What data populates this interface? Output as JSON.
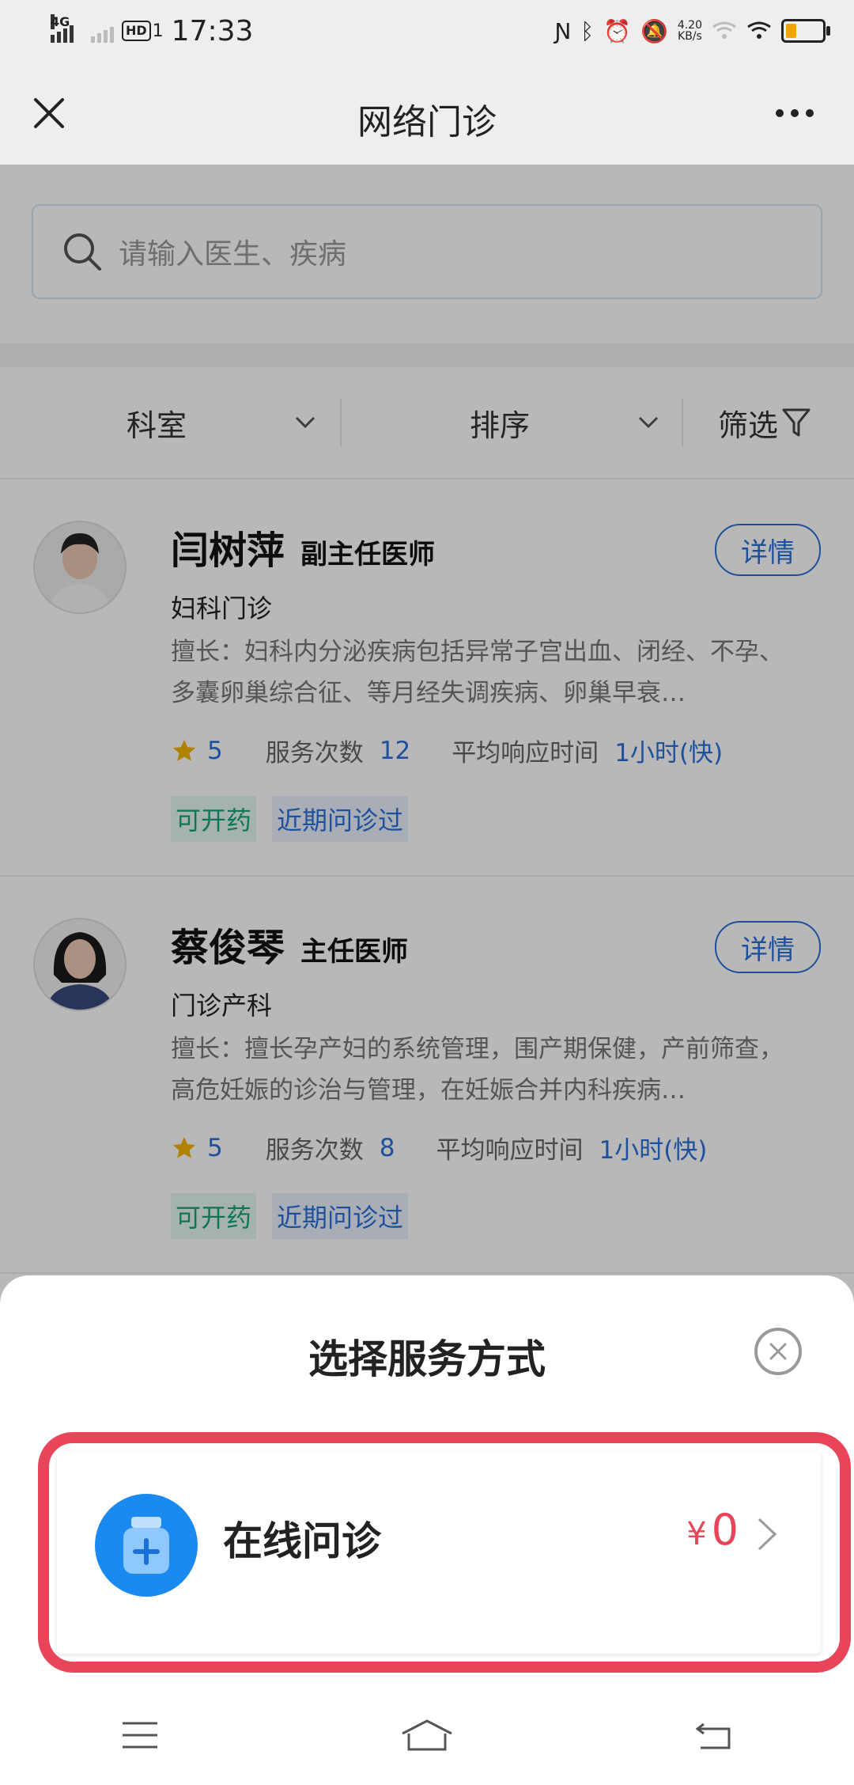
{
  "status_bar": {
    "network": "4G",
    "hd": "HD",
    "hd_sub": "1",
    "time": "17:33",
    "speed_value": "4.20",
    "speed_unit": "KB/s"
  },
  "nav": {
    "title": "网络门诊"
  },
  "search": {
    "placeholder": "请输入医生、疾病"
  },
  "filters": {
    "dept": "科室",
    "sort": "排序",
    "filter": "筛选"
  },
  "doctors": [
    {
      "name": "闫树萍",
      "title": "副主任医师",
      "detail_label": "详情",
      "dept": "妇科门诊",
      "skill": "擅长：妇科内分泌疾病包括异常子宫出血、闭经、不孕、多囊卵巢综合征、等月经失调疾病、卵巢早衰…",
      "rating": "5",
      "service_label": "服务次数",
      "service_count": "12",
      "response_label": "平均响应时间",
      "response_time": "1小时(快)",
      "tags": [
        "可开药",
        "近期问诊过"
      ]
    },
    {
      "name": "蔡俊琴",
      "title": "主任医师",
      "detail_label": "详情",
      "dept": "门诊产科",
      "skill": "擅长：擅长孕产妇的系统管理，围产期保健，产前筛查，高危妊娠的诊治与管理，在妊娠合并内科疾病…",
      "rating": "5",
      "service_label": "服务次数",
      "service_count": "8",
      "response_label": "平均响应时间",
      "response_time": "1小时(快)",
      "tags": [
        "可开药",
        "近期问诊过"
      ]
    }
  ],
  "sheet": {
    "title": "选择服务方式",
    "service_label": "在线问诊",
    "currency": "¥",
    "price": "0"
  },
  "colors": {
    "accent_blue": "#2a6fd8",
    "highlight_red": "#e8455a",
    "tag_green": "#14a27a"
  }
}
